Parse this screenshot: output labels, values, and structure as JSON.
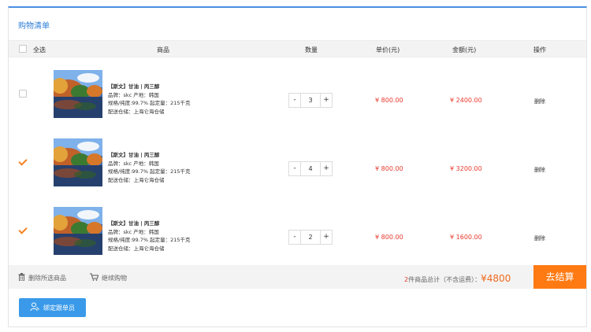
{
  "cart": {
    "title": "购物清单",
    "headers": {
      "select_all": "全选",
      "product": "商品",
      "quantity": "数量",
      "unit_price": "单价(元)",
      "amount": "金额(元)",
      "action": "操作"
    },
    "items": [
      {
        "checked": false,
        "name": "【斯文】甘油 | 丙三醇",
        "brand": "品牌：skc  产地：韩国",
        "spec": "规格/纯度:99.7%  起定量：215千克",
        "warehouse": "配送仓储：上海仑海仓储",
        "quantity": "3",
        "unit_price": "¥ 800.00",
        "amount": "¥ 2400.00",
        "delete_label": "删除"
      },
      {
        "checked": true,
        "name": "【斯文】甘油 | 丙三醇",
        "brand": "品牌：skc  产地：韩国",
        "spec": "规格/纯度:99.7%  起定量：215千克",
        "warehouse": "配送仓储：上海仑海仓储",
        "quantity": "4",
        "unit_price": "¥ 800.00",
        "amount": "¥ 3200.00",
        "delete_label": "删除"
      },
      {
        "checked": true,
        "name": "【斯文】甘油 | 丙三醇",
        "brand": "品牌：skc  产地：韩国",
        "spec": "规格/纯度:99.7%  起定量：215千克",
        "warehouse": "配送仓储：上海仑海仓储",
        "quantity": "2",
        "unit_price": "¥ 800.00",
        "amount": "¥ 1600.00",
        "delete_label": "删除"
      }
    ],
    "minus_label": "-",
    "plus_label": "+",
    "footer": {
      "delete_selected": "删除所选商品",
      "continue_shopping": "继续购物",
      "count": "2",
      "summary_text": "件商品总计（不含运费）：",
      "total": "¥4800",
      "checkout": "去结算"
    },
    "bind_button": "绑定跟单员"
  },
  "colors": {
    "accent_blue": "#2f7ed8",
    "price_red": "#e8392d",
    "checkout_orange": "#ff7a12",
    "check_orange": "#f5821f",
    "button_blue": "#3a9ae9"
  },
  "icons": {
    "trash": "trash-icon",
    "cart": "cart-icon",
    "user": "user-icon",
    "check": "check-icon"
  }
}
